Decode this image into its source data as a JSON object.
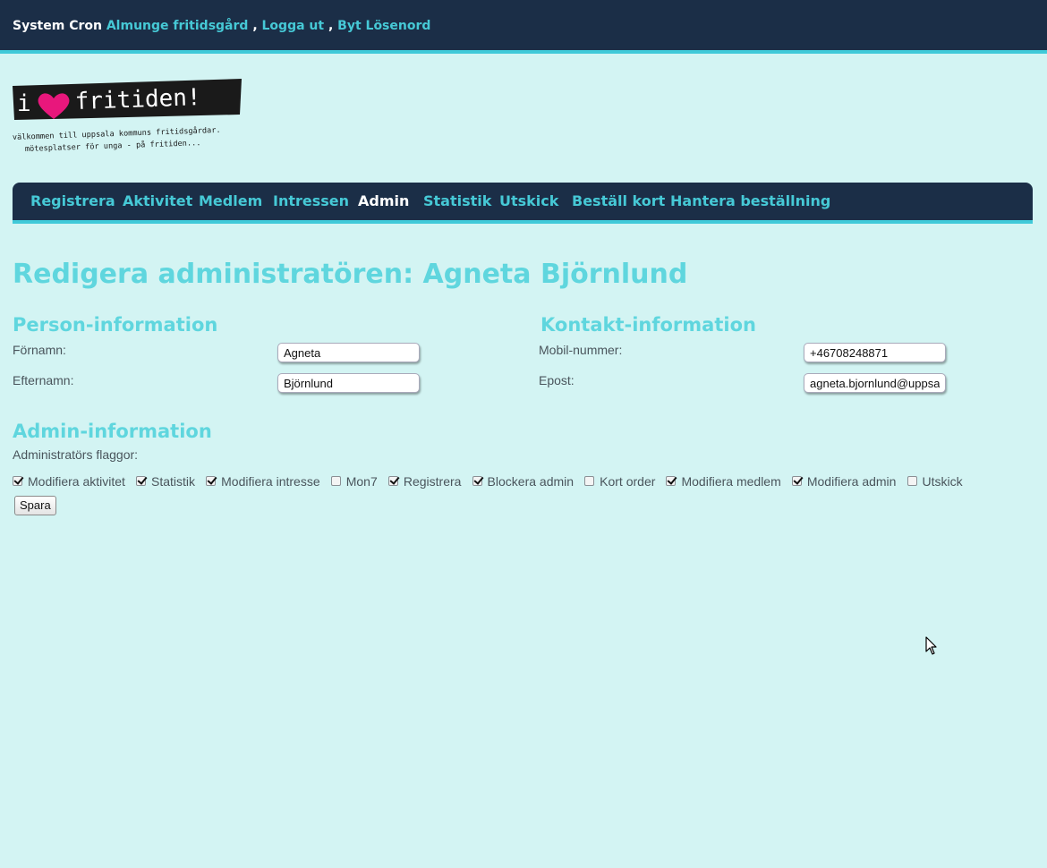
{
  "topbar": {
    "user": "System Cron",
    "links": [
      "Almunge fritidsgård",
      "Logga ut",
      "Byt Lösenord"
    ],
    "separator": ","
  },
  "logo": {
    "brand_i": "i",
    "brand_word": "fritiden!",
    "tagline1": "välkommen till uppsala kommuns fritidsgårdar.",
    "tagline2": "mötesplatser för unga - på fritiden..."
  },
  "nav": {
    "items": [
      "Registrera",
      "Aktivitet",
      "Medlem",
      "Intressen",
      "Admin",
      "Statistik",
      "Utskick",
      "Beställ kort",
      "Hantera beställning"
    ],
    "active": "Admin"
  },
  "page": {
    "title": "Redigera administratören: Agneta Björnlund"
  },
  "person": {
    "heading": "Person-information",
    "first_label": "Förnamn:",
    "first_value": "Agneta",
    "last_label": "Efternamn:",
    "last_value": "Björnlund"
  },
  "contact": {
    "heading": "Kontakt-information",
    "mobile_label": "Mobil-nummer:",
    "mobile_value": "+46708248871",
    "email_label": "Epost:",
    "email_value": "agneta.bjornlund@uppsala"
  },
  "admin": {
    "heading": "Admin-information",
    "flags_label": "Administratörs flaggor:",
    "flags": [
      {
        "label": "Modifiera aktivitet",
        "checked": true
      },
      {
        "label": "Statistik",
        "checked": true
      },
      {
        "label": "Modifiera intresse",
        "checked": true
      },
      {
        "label": "Mon7",
        "checked": false
      },
      {
        "label": "Registrera",
        "checked": true
      },
      {
        "label": "Blockera admin",
        "checked": true
      },
      {
        "label": "Kort order",
        "checked": false
      },
      {
        "label": "Modifiera medlem",
        "checked": true
      },
      {
        "label": "Modifiera admin",
        "checked": true
      },
      {
        "label": "Utskick",
        "checked": false
      }
    ],
    "save_label": "Spara"
  },
  "colors": {
    "background": "#d3f4f3",
    "navbar": "#1b2e47",
    "accent": "#46c9d6",
    "heading": "#5fd6de",
    "heart": "#e8177c"
  }
}
